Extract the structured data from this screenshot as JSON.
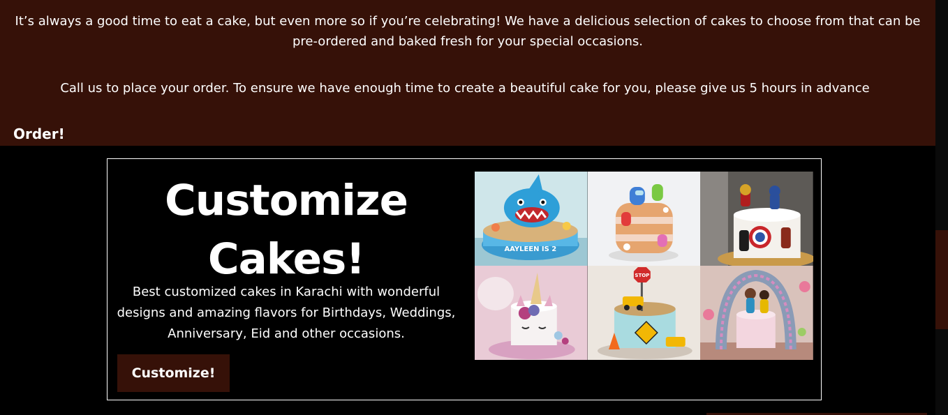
{
  "intro": {
    "paragraph": "It’s always a good time to eat a cake, but even more so if you’re celebrating! We have a delicious selection of cakes to choose from that can be pre-ordered and baked fresh for your special occasions.",
    "call_text": "Call us to place your order. To ensure we have enough time to create a beautiful cake for you, please give us 5 hours in advance",
    "order_button": "Order!"
  },
  "customize": {
    "title": "Customize Cakes!",
    "description": "Best customized cakes in Karachi with wonderful designs and amazing flavors for Birthdays, Weddings, Anniversary, Eid and other occasions.",
    "button": "Customize!",
    "gallery": [
      {
        "icon": "shark-cake-image",
        "plaque": "AAYLEEN IS 2"
      },
      {
        "icon": "among-us-cake-image",
        "plaque": ""
      },
      {
        "icon": "superhero-cake-image",
        "plaque": ""
      },
      {
        "icon": "unicorn-cake-image",
        "plaque": ""
      },
      {
        "icon": "construction-cake-image",
        "plaque": "STOP"
      },
      {
        "icon": "princess-cake-image",
        "plaque": ""
      }
    ]
  },
  "colors": {
    "brand_brown": "#361108",
    "background": "#000000",
    "text": "#ffffff"
  }
}
